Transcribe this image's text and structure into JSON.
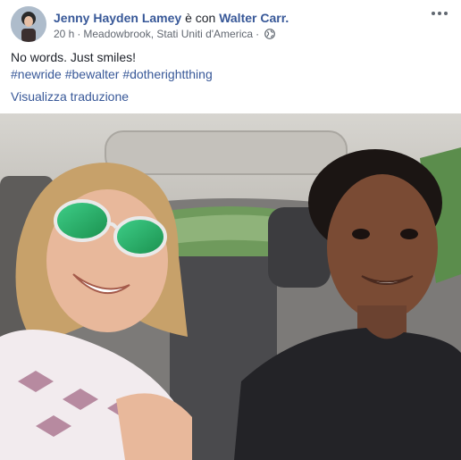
{
  "post": {
    "author": "Jenny Hayden Lamey",
    "with_text": "è con",
    "tagged": "Walter Carr.",
    "time": "20 h",
    "location": "Meadowbrook, Stati Uniti d'America",
    "privacy_icon": "globe-icon",
    "text": "No words. Just smiles!",
    "hashtags": [
      "#newride",
      "#bewalter",
      "#dotherightthing"
    ],
    "translate_label": "Visualizza traduzione"
  },
  "photo": {
    "subject": "selfie-in-car"
  },
  "colors": {
    "link": "#385898",
    "text": "#1d2129",
    "meta": "#616770"
  }
}
